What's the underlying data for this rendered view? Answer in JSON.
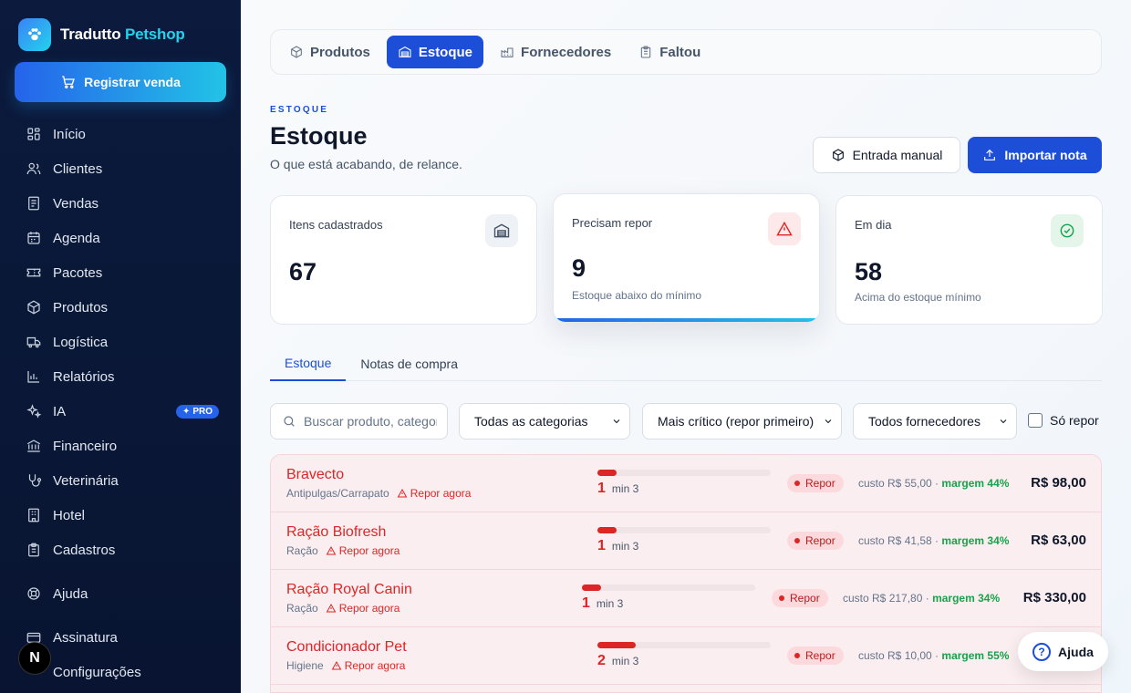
{
  "brand": {
    "name_main": "Tradutto",
    "name_accent": "Petshop"
  },
  "sidebar": {
    "cta_label": "Registrar venda",
    "items": [
      {
        "label": "Início",
        "icon": "grid-icon"
      },
      {
        "label": "Clientes",
        "icon": "users-icon"
      },
      {
        "label": "Vendas",
        "icon": "receipt-icon"
      },
      {
        "label": "Agenda",
        "icon": "calendar-icon"
      },
      {
        "label": "Pacotes",
        "icon": "ticket-icon"
      },
      {
        "label": "Produtos",
        "icon": "package-icon"
      },
      {
        "label": "Logística",
        "icon": "truck-icon"
      },
      {
        "label": "Relatórios",
        "icon": "bar-chart-icon"
      },
      {
        "label": "IA",
        "icon": "sparkles-icon",
        "badge": "PRO"
      },
      {
        "label": "Financeiro",
        "icon": "bank-icon"
      },
      {
        "label": "Veterinária",
        "icon": "stethoscope-icon"
      },
      {
        "label": "Hotel",
        "icon": "building-icon"
      },
      {
        "label": "Cadastros",
        "icon": "clipboard-icon"
      }
    ],
    "help_label": "Ajuda",
    "subscription_label": "Assinatura",
    "settings_label": "Configurações",
    "avatar_letter": "N"
  },
  "topnav": {
    "items": [
      {
        "label": "Produtos",
        "active": false
      },
      {
        "label": "Estoque",
        "active": true
      },
      {
        "label": "Fornecedores",
        "active": false
      },
      {
        "label": "Faltou",
        "active": false
      }
    ]
  },
  "header": {
    "eyebrow": "ESTOQUE",
    "title": "Estoque",
    "subtitle": "O que está acabando, de relance.",
    "manual_entry_label": "Entrada manual",
    "import_label": "Importar nota"
  },
  "stats": [
    {
      "label": "Itens cadastrados",
      "value": "67",
      "sub": ""
    },
    {
      "label": "Precisam repor",
      "value": "9",
      "sub": "Estoque abaixo do mínimo"
    },
    {
      "label": "Em dia",
      "value": "58",
      "sub": "Acima do estoque mínimo"
    }
  ],
  "tabs": {
    "stock": "Estoque",
    "purchase_notes": "Notas de compra"
  },
  "filters": {
    "search_placeholder": "Buscar produto, categoria…",
    "category": "Todas as categorias",
    "sort": "Mais crítico (repor primeiro)",
    "supplier": "Todos fornecedores",
    "only_restock": "Só repor"
  },
  "products": [
    {
      "name": "Bravecto",
      "category": "Antipulgas/Carrapato",
      "alert": "Repor agora",
      "qty": "1",
      "min": "min 3",
      "level": 0.11,
      "status": "Repor",
      "cost": "custo R$ 55,00 ·",
      "margin": "margem 44%",
      "price": "R$ 98,00"
    },
    {
      "name": "Ração Biofresh",
      "category": "Ração",
      "alert": "Repor agora",
      "qty": "1",
      "min": "min 3",
      "level": 0.11,
      "status": "Repor",
      "cost": "custo R$ 41,58 ·",
      "margin": "margem 34%",
      "price": "R$ 63,00"
    },
    {
      "name": "Ração Royal Canin",
      "category": "Ração",
      "alert": "Repor agora",
      "qty": "1",
      "min": "min 3",
      "level": 0.11,
      "status": "Repor",
      "cost": "custo R$ 217,80 ·",
      "margin": "margem 34%",
      "price": "R$ 330,00"
    },
    {
      "name": "Condicionador Pet",
      "category": "Higiene",
      "alert": "Repor agora",
      "qty": "2",
      "min": "min 3",
      "level": 0.22,
      "status": "Repor",
      "cost": "custo R$ 10,00 ·",
      "margin": "margem 55%",
      "price": ""
    }
  ],
  "help_button": "Ajuda",
  "colors": {
    "primary": "#1d4ed8",
    "danger": "#dc2626",
    "success": "#16a34a",
    "sidebar": "#0b1a3d",
    "accent": "#22d3ee"
  }
}
